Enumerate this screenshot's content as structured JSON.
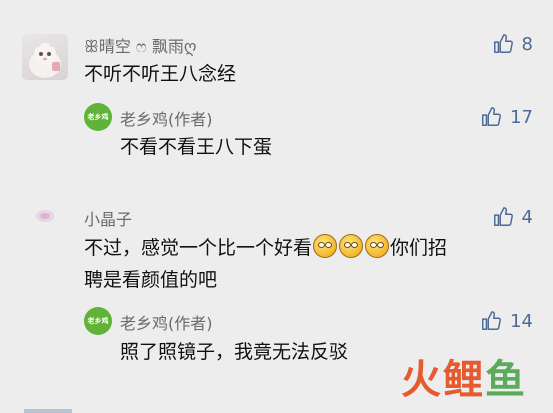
{
  "comments": [
    {
      "author": "ꕥ晴空 ෆ 飘雨ღ",
      "text": "不听不听王八念经",
      "likes": "8",
      "reply": {
        "author": "老乡鸡(作者)",
        "avatar_label": "老乡鸡",
        "text": "不看不看王八下蛋",
        "likes": "17"
      }
    },
    {
      "author": "小晶子",
      "text_line1_start": "不过，感觉一个比一个好看",
      "text_line1_end": "你们招",
      "text_line2": "聘是看颜值的吧",
      "likes": "4",
      "reply": {
        "author": "老乡鸡(作者)",
        "avatar_label": "老乡鸡",
        "text": "照了照镜子，我竟无法反驳",
        "likes": "14"
      }
    }
  ],
  "watermark": {
    "part1": "火鲤",
    "part2": "鱼"
  },
  "colors": {
    "accent": "#4d6a95",
    "reply_avatar": "#5fb336",
    "background": "#ededed"
  },
  "icons": [
    "thumbs-up-icon",
    "laughing-emoji-icon"
  ]
}
